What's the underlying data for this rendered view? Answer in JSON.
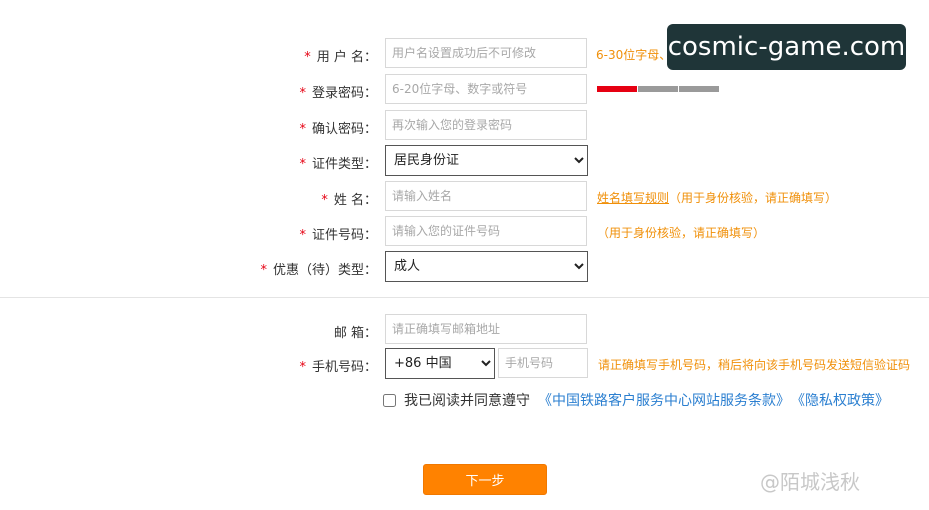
{
  "form": {
    "username": {
      "label": "用 户 名：",
      "placeholder": "用户名设置成功后不可修改",
      "hint": "6-30位字母、"
    },
    "password": {
      "label": "登录密码：",
      "placeholder": "6-20位字母、数字或符号"
    },
    "confirm_password": {
      "label": "确认密码：",
      "placeholder": "再次输入您的登录密码"
    },
    "id_type": {
      "label": "证件类型：",
      "selected": "居民身份证"
    },
    "name": {
      "label": "姓 名：",
      "placeholder": "请输入姓名",
      "rule_link": "姓名填写规则",
      "hint": "（用于身份核验，请正确填写）"
    },
    "id_number": {
      "label": "证件号码：",
      "placeholder": "请输入您的证件号码",
      "hint": "（用于身份核验，请正确填写）"
    },
    "discount_type": {
      "label": "优惠（待）类型：",
      "selected": "成人"
    },
    "email": {
      "label": "邮 箱：",
      "placeholder": "请正确填写邮箱地址"
    },
    "phone": {
      "label": "手机号码：",
      "country_code": "+86 中国",
      "placeholder": "手机号码",
      "hint": "请正确填写手机号码，稍后将向该手机号码发送短信验证码"
    },
    "required_mark": "*"
  },
  "agreement": {
    "text": "我已阅读并同意遵守",
    "terms_link": "《中国铁路客户服务中心网站服务条款》",
    "privacy_link": "《隐私权政策》",
    "checked": false
  },
  "next_button": {
    "label": "下一步"
  },
  "password_strength": {
    "level": 1,
    "of": 3,
    "color_active": "#e60012"
  },
  "overlay": {
    "domain_badge": "cosmic-game.com",
    "watermark": "@陌城浅秋"
  },
  "colors": {
    "accent": "#ff8200",
    "hint": "#f0900a",
    "link": "#2b7fd0",
    "required": "#e60012"
  }
}
